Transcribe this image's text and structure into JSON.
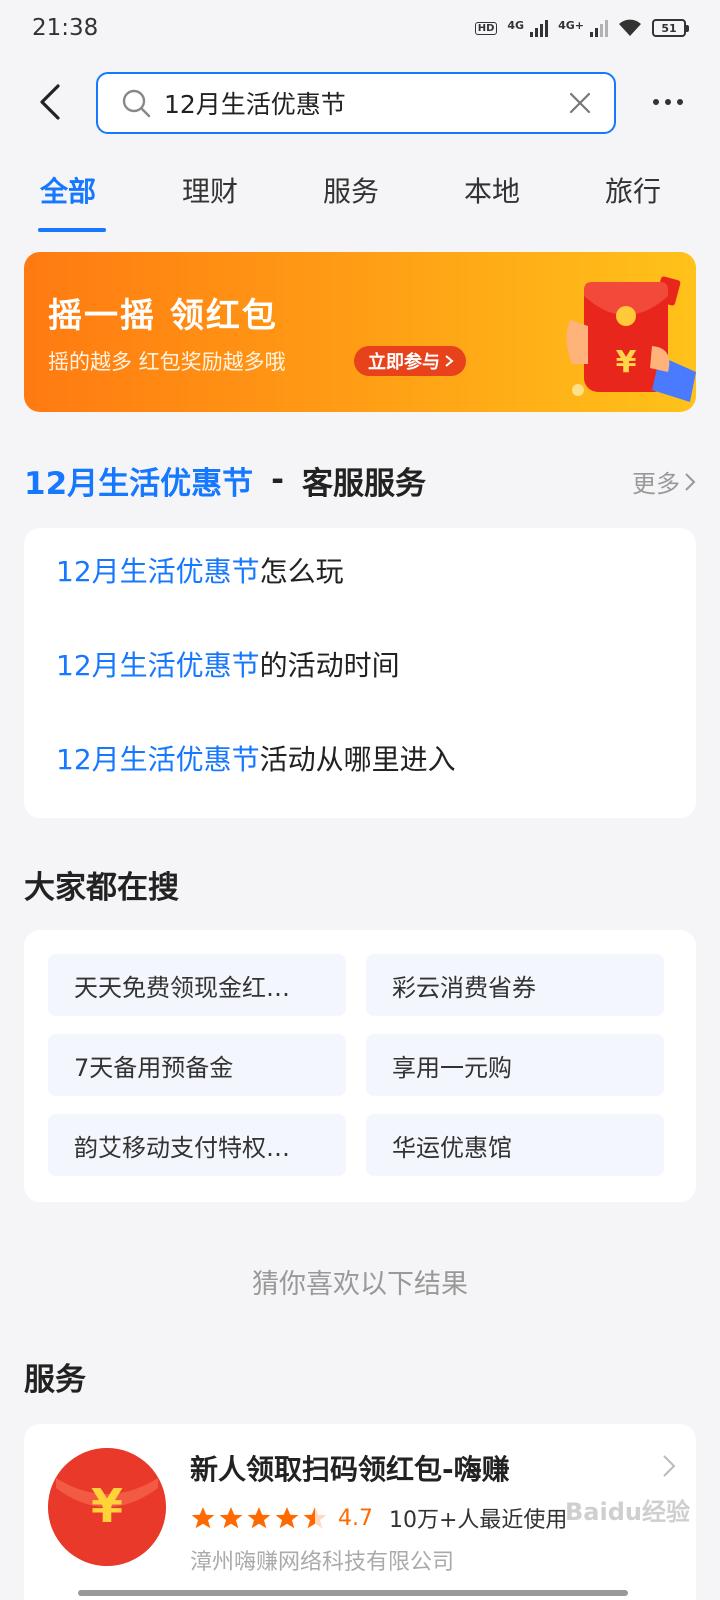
{
  "status_bar": {
    "time": "21:38",
    "hd_label": "HD",
    "network_1": "4G",
    "network_2": "4G+",
    "battery": "51"
  },
  "search": {
    "query": "12月生活优惠节"
  },
  "tabs": [
    {
      "label": "全部",
      "active": true
    },
    {
      "label": "理财",
      "active": false
    },
    {
      "label": "服务",
      "active": false
    },
    {
      "label": "本地",
      "active": false
    },
    {
      "label": "旅行",
      "active": false
    }
  ],
  "banner": {
    "title": "摇一摇 领红包",
    "subtitle": "摇的越多 红包奖励越多哦",
    "cta": "立即参与"
  },
  "service_section": {
    "keyword": "12月生活优惠节",
    "separator": "-",
    "title": "客服服务",
    "more": "更多",
    "items": [
      {
        "highlight": "12月生活优惠节",
        "rest": "怎么玩"
      },
      {
        "highlight": "12月生活优惠节",
        "rest": "的活动时间"
      },
      {
        "highlight": "12月生活优惠节",
        "rest": "活动从哪里进入"
      }
    ]
  },
  "hot_search": {
    "title": "大家都在搜",
    "items": [
      "天天免费领现金红…",
      "彩云消费省券",
      "7天备用预备金",
      "享用一元购",
      "韵艾移动支付特权…",
      "华运优惠馆"
    ]
  },
  "guess": "猜你喜欢以下结果",
  "services": {
    "title": "服务",
    "card": {
      "name": "新人领取扫码领红包-嗨赚",
      "rating": "4.7",
      "rating_value": 4.7,
      "users": "10万+人最近使用",
      "company": "漳州嗨赚网络科技有限公司"
    }
  },
  "watermark": "Baidu经验",
  "colors": {
    "accent": "#1677ff",
    "banner_start": "#ff7a12",
    "banner_end": "#ffc21a",
    "star": "#ff6a00"
  }
}
